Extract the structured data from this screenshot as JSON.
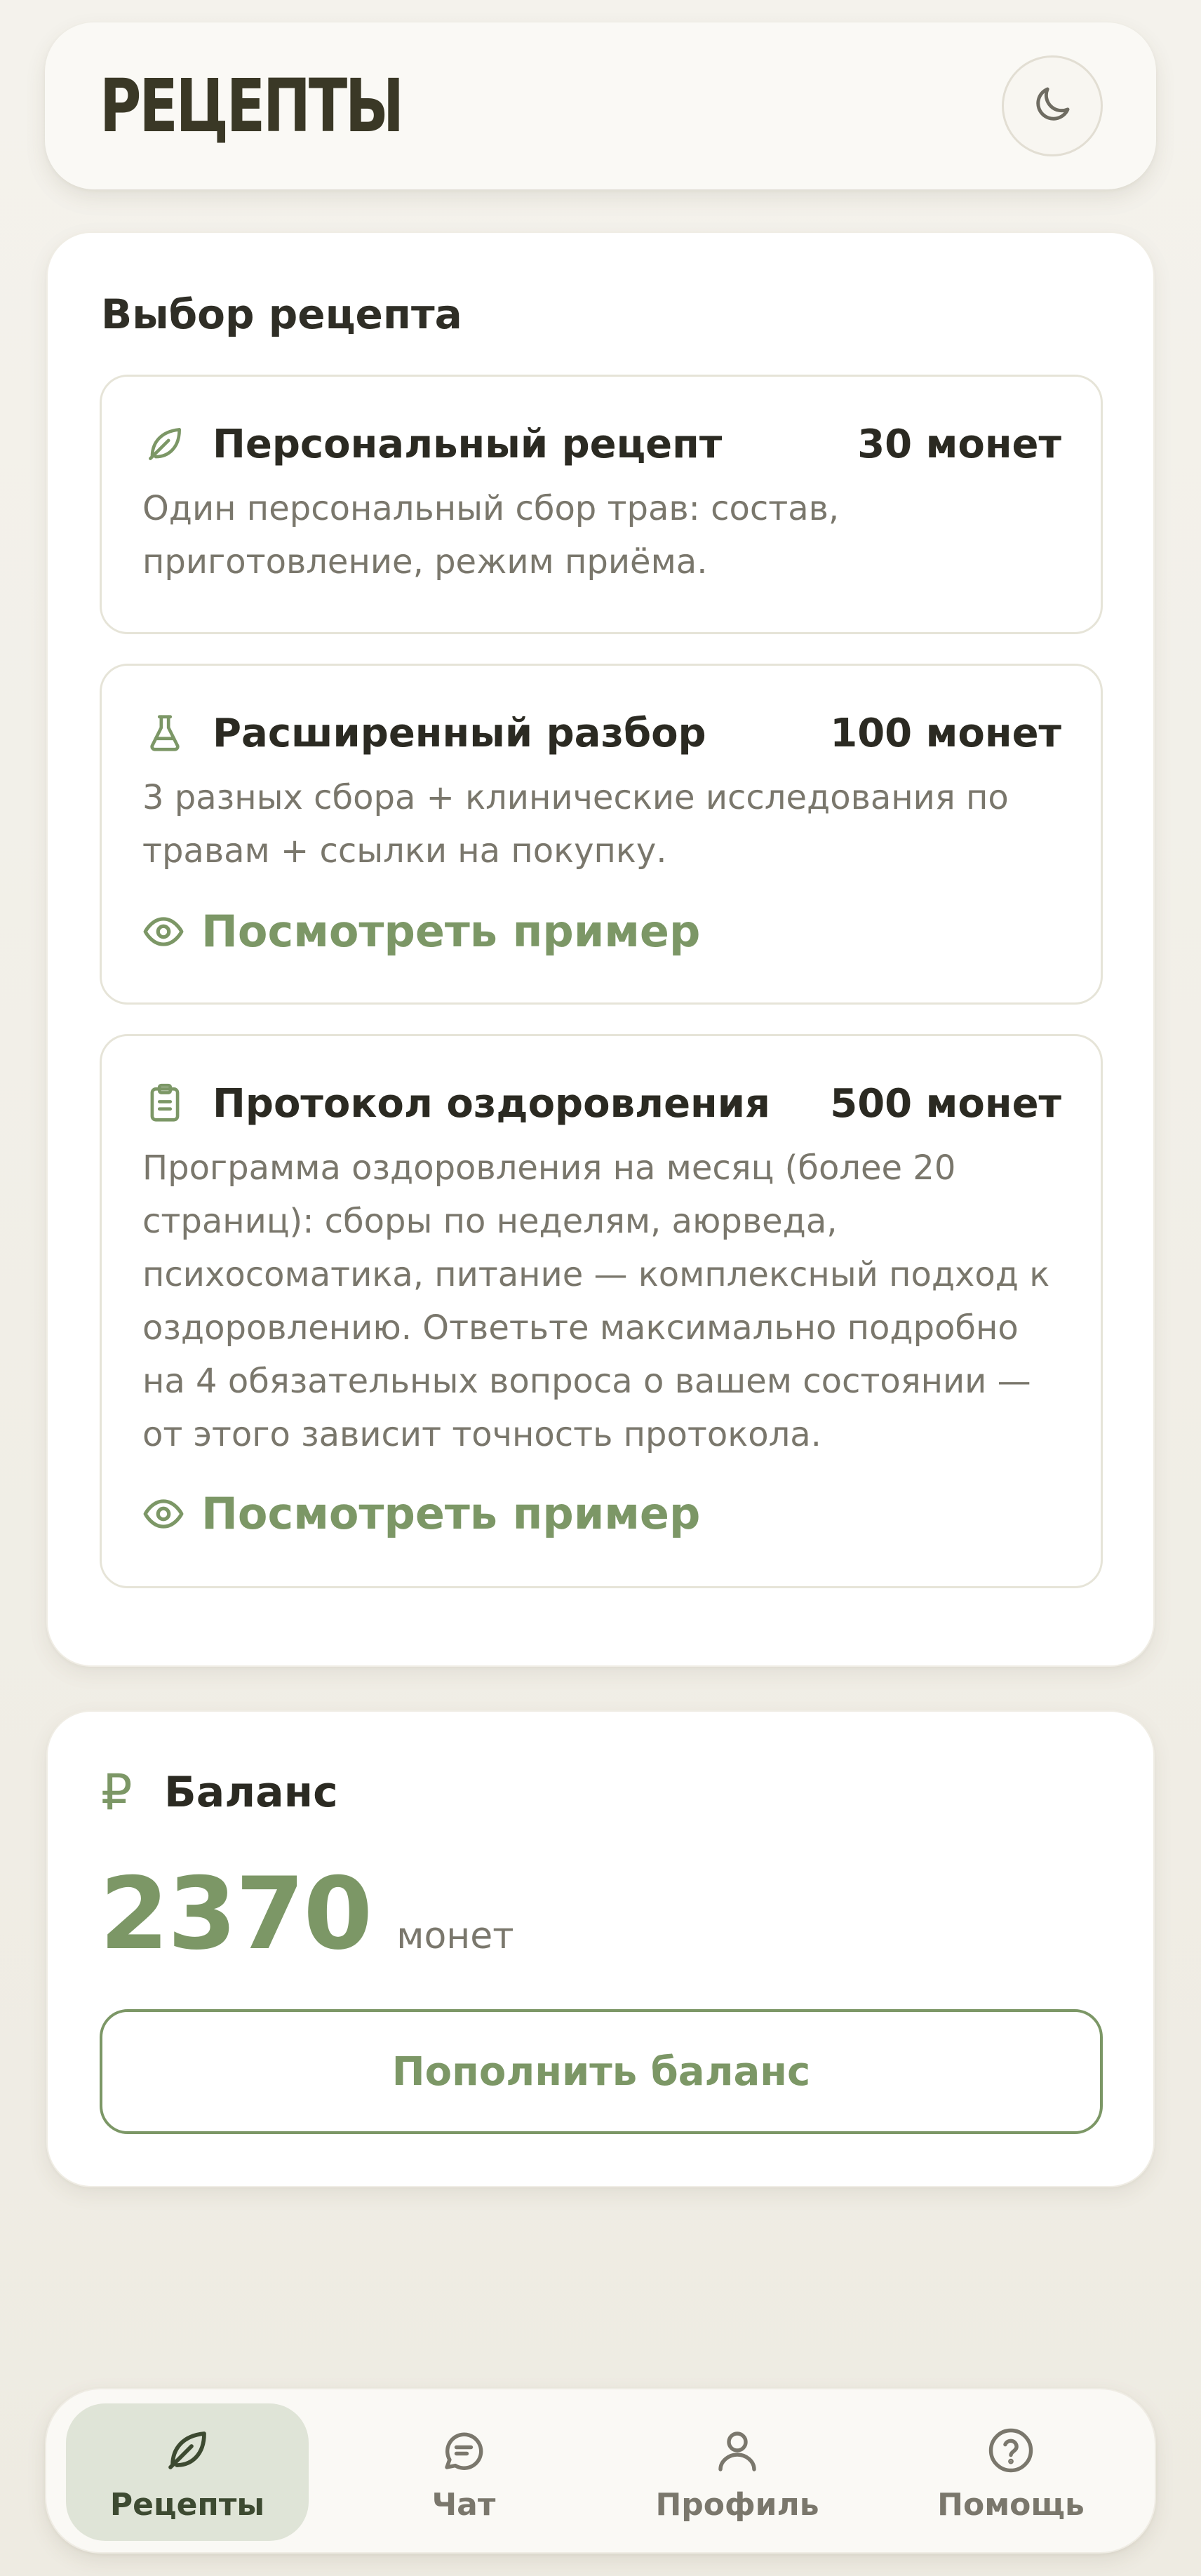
{
  "app": {
    "title": "РЕЦЕПТЫ",
    "theme_toggle_icon": "moon-icon"
  },
  "selection": {
    "title": "Выбор рецепта",
    "options": [
      {
        "icon": "leaf-icon",
        "title": "Персональный рецепт",
        "price": "30 монет",
        "description": "Один персональный сбор трав: состав, приготовление, режим приёма."
      },
      {
        "icon": "flask-icon",
        "title": "Расширенный разбор",
        "price": "100 монет",
        "description": "3 разных сбора + клинические исследования по травам + ссылки на покупку.",
        "example_label": "Посмотреть пример"
      },
      {
        "icon": "clipboard-icon",
        "title": "Протокол оздоровления",
        "price": "500 монет",
        "description": "Программа оздоровления на месяц (более 20 страниц): сборы по неделям, аюрведа, психосоматика, питание — комплексный подход к оздоровлению. Ответьте максимально подробно на 4 обязательных вопроса о вашем состоянии — от этого зависит точность протокола.",
        "example_label": "Посмотреть пример"
      }
    ]
  },
  "balance": {
    "icon": "ruble-icon",
    "symbol": "₽",
    "label": "Баланс",
    "amount": "2370",
    "unit": "монет",
    "topup_label": "Пополнить баланс"
  },
  "nav": {
    "items": [
      {
        "icon": "leaf-icon",
        "label": "Рецепты",
        "active": true
      },
      {
        "icon": "chat-icon",
        "label": "Чат",
        "active": false
      },
      {
        "icon": "user-icon",
        "label": "Профиль",
        "active": false
      },
      {
        "icon": "help-icon",
        "label": "Помощь",
        "active": false
      }
    ]
  },
  "colors": {
    "accent": "#7c9766",
    "text": "#2b2a22",
    "muted": "#7a776c",
    "nav_active_bg": "#dfe4d7"
  }
}
